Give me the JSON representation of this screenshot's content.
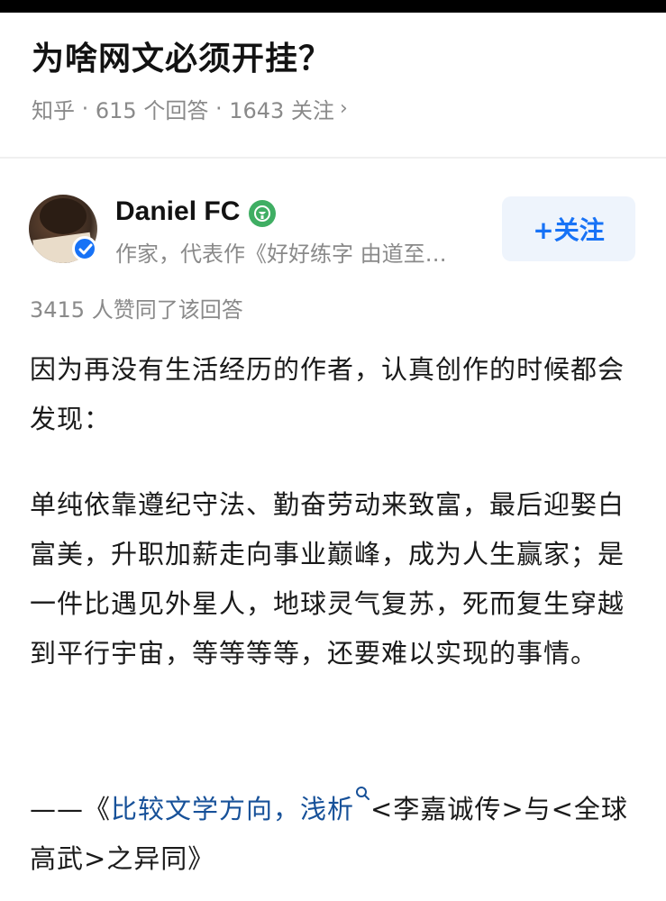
{
  "question": {
    "title": "为啥网文必须开挂？",
    "source": "知乎",
    "answers": "615 个回答",
    "followers": "1643 关注",
    "separator": " · "
  },
  "author": {
    "name": "Daniel FC",
    "description": "作家，代表作《好好练字 由道至…",
    "follow_label": "+关注"
  },
  "answer": {
    "likes": "3415 人赞同了该回答",
    "paragraph1": "因为再没有生活经历的作者，认真创作的时候都会发现：",
    "paragraph2": "单纯依靠遵纪守法、勤奋劳动来致富，最后迎娶白富美，升职加薪走向事业巅峰，成为人生赢家；是一件比遇见外星人，地球灵气复苏，死而复生穿越到平行宇宙，等等等等，还要难以实现的事情。",
    "citation_prefix": "——《",
    "citation_link": "比较文学方向，浅析",
    "citation_rest": "<李嘉诚传>与<全球高武>之异同》"
  },
  "colors": {
    "link": "#175199",
    "accent": "#1772f6",
    "meta": "#8a8a8a"
  }
}
